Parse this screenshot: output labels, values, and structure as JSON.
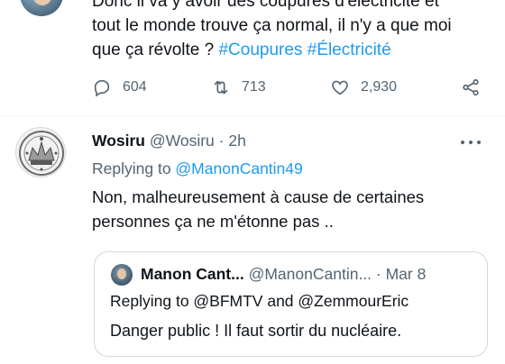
{
  "top_tweet": {
    "text_line1": "Donc il va y avoir des coupures d'électricité et",
    "text_line2": "tout le monde trouve ça normal, il n'y a que moi",
    "text_line3_prefix": "que ça révolte ? ",
    "hashtag1": "#Coupures",
    "hashtag2": "#Électricité",
    "reply_count": "604",
    "retweet_count": "713",
    "like_count": "2,930"
  },
  "reply_tweet": {
    "name": "Wosiru",
    "handle": "@Wosiru",
    "separator": " · ",
    "time": "2h",
    "replying_label": "Replying to ",
    "replying_to": "@ManonCantin49",
    "text_line1": "Non, malheureusement à cause de certaines",
    "text_line2": "personnes ça ne m'étonne pas .."
  },
  "quoted_tweet": {
    "name": "Manon Cant...",
    "handle": "@ManonCantin...",
    "separator": " · ",
    "date": "Mar 8",
    "replying_text": "Replying to @BFMTV and @ZemmourEric",
    "text": "Danger public ! Il faut sortir du nucléaire."
  },
  "colors": {
    "accent": "#1d9bf0",
    "text": "#0f1419",
    "secondary": "#536471",
    "border": "#cfd9de"
  },
  "icons": [
    "reply-icon",
    "retweet-icon",
    "like-icon",
    "share-icon",
    "more-icon"
  ]
}
